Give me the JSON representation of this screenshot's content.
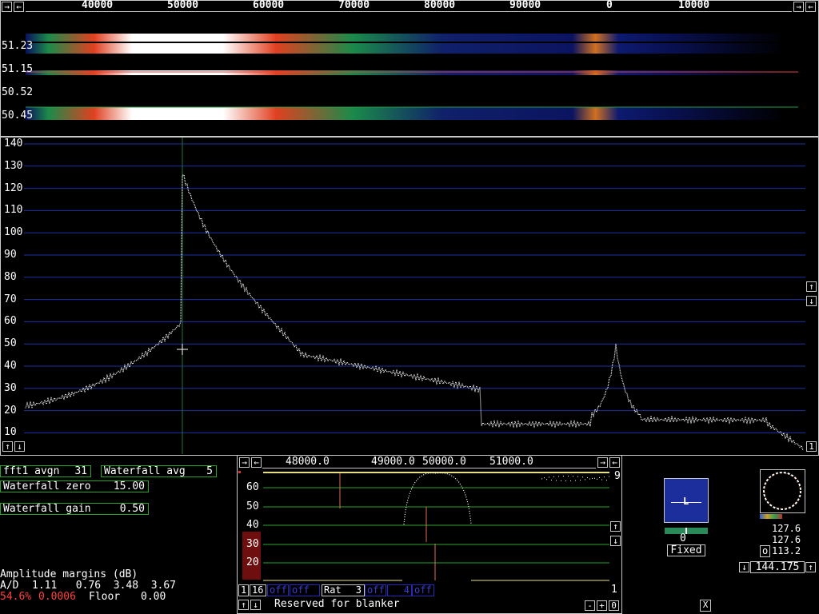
{
  "waterfall": {
    "freq_labels": [
      "40000",
      "50000",
      "60000",
      "70000",
      "80000",
      "90000",
      "0",
      "10000"
    ],
    "time_labels": [
      "51.23",
      "51.15",
      "50.52",
      "50.45"
    ]
  },
  "spectrum": {
    "y_ticks": [
      "140",
      "130",
      "120",
      "110",
      "100",
      "90",
      "80",
      "70",
      "60",
      "50",
      "40",
      "30",
      "20",
      "10"
    ],
    "scroll_right_bottom_label": "1"
  },
  "controls": {
    "fft1_avgn_label": "fft1 avgn",
    "fft1_avgn_value": "31",
    "waterfall_avg_label": "Waterfall avg",
    "waterfall_avg_value": "5",
    "waterfall_zero_label": "Waterfall zero",
    "waterfall_zero_value": "15.00",
    "waterfall_gain_label": "Waterfall gain",
    "waterfall_gain_value": "0.50"
  },
  "amplitude": {
    "title": "Amplitude margins (dB)",
    "ad_label": "A/D",
    "ad_values": "1.11   0.76  3.48  3.67",
    "percent": "54.6%",
    "ratio": "0.0006",
    "floor_label": "Floor",
    "floor_value": "0.00"
  },
  "baseband": {
    "freq_labels": [
      "48000.0",
      "49000.0",
      "50000.0",
      "51000.0"
    ],
    "y_ticks": [
      "60",
      "50",
      "40",
      "30",
      "20"
    ],
    "right_top_label": "9",
    "right_bottom_label": "1",
    "left_bottom_label": "1",
    "bw_value": "16",
    "off1": "off",
    "off2": "off",
    "rat_label": "Rat",
    "rat_value": "3",
    "off3": "off",
    "num_value": "4",
    "off4": "off",
    "status": "Reserved for blanker",
    "minus": "-",
    "plus": "+",
    "zero": "0"
  },
  "smeter": {
    "letter": "L",
    "value": "0",
    "mode": "Fixed"
  },
  "coherent": {
    "v1": "127.6",
    "v2": "127.6",
    "o_label": "o",
    "v3": "113.2",
    "freq": "144.175"
  },
  "close_label": "X",
  "colors": {
    "grid_blue": "#1c2fa8",
    "green": "#2aa52a",
    "red_text": "#ff4040",
    "white": "#ffffff"
  }
}
